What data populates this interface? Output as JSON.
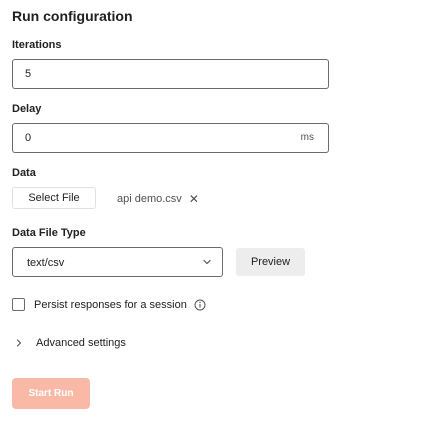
{
  "panel": {
    "title": "Run configuration"
  },
  "iterations": {
    "label": "Iterations",
    "value": "5"
  },
  "delay": {
    "label": "Delay",
    "value": "0",
    "unit": "ms"
  },
  "data_section": {
    "label": "Data",
    "select_file_label": "Select File",
    "file_name": "api demo.csv",
    "remove_icon": "close-icon"
  },
  "data_file_type": {
    "label": "Data File Type",
    "selected": "text/csv",
    "preview_label": "Preview"
  },
  "persist": {
    "label": "Persist responses for a session",
    "checked": false,
    "icon": "info-icon"
  },
  "advanced": {
    "label": "Advanced settings",
    "expanded": false
  },
  "start_button": {
    "label": "Start Run",
    "color": "#f9b9a6",
    "disabled": true
  }
}
